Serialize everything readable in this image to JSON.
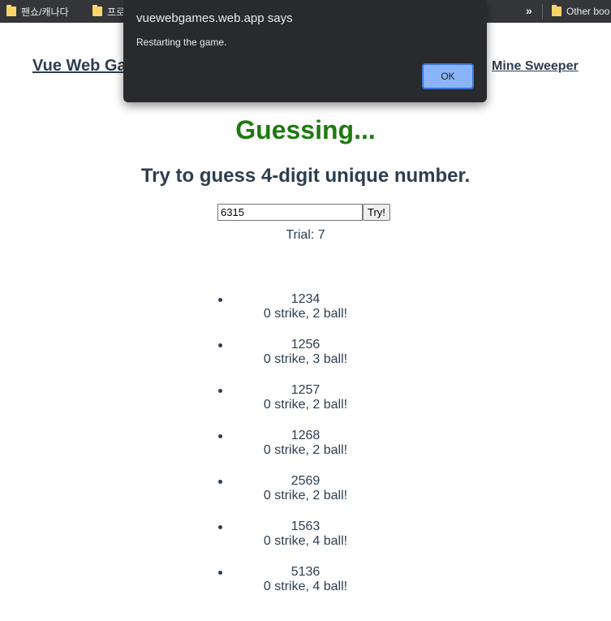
{
  "bookmarks_bar": {
    "items": [
      {
        "label": "팬쇼/캐나다",
        "icon": "folder-icon"
      },
      {
        "label": "프로",
        "icon": "folder-icon"
      }
    ],
    "more_label": "»",
    "other_label": "Other boo"
  },
  "nav": {
    "home_label": "Vue Web Ga",
    "mine_sweeper_label": "Mine Sweeper"
  },
  "game": {
    "title": "Guessing...",
    "subtitle": "Try to guess 4-digit unique number.",
    "input_value": "6315",
    "try_label": "Try!",
    "trial_label": "Trial:",
    "trial_value": "7",
    "history": [
      {
        "number": "1234",
        "result": "0 strike, 2 ball!"
      },
      {
        "number": "1256",
        "result": "0 strike, 3 ball!"
      },
      {
        "number": "1257",
        "result": "0 strike, 2 ball!"
      },
      {
        "number": "1268",
        "result": "0 strike, 2 ball!"
      },
      {
        "number": "2569",
        "result": "0 strike, 2 ball!"
      },
      {
        "number": "1563",
        "result": "0 strike, 4 ball!"
      },
      {
        "number": "5136",
        "result": "0 strike, 4 ball!"
      }
    ]
  },
  "dialog": {
    "title": "vuewebgames.web.app says",
    "message": "Restarting the game.",
    "ok_label": "OK"
  },
  "colors": {
    "title_green": "#1e7a10",
    "text_dark": "#2c3e50",
    "dialog_bg": "#292a2d",
    "ok_button": "#8ab4f8"
  }
}
